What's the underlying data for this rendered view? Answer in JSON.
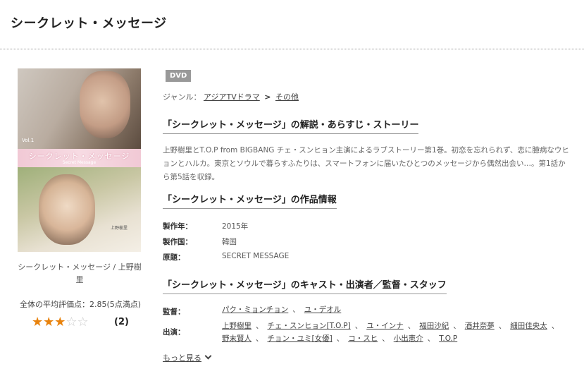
{
  "page_title": "シークレット・メッセージ",
  "cover": {
    "band_text": "シークレット・メッセージ",
    "band_sub": "Secret Message",
    "vol": "Vol.1",
    "cast_mark": "上野樹里"
  },
  "cover_caption": "シークレット・メッセージ / 上野樹里",
  "rating": {
    "summary": "全体の平均評価点：2.85(5点満点)",
    "stars_on": "★★★",
    "stars_off": "☆☆",
    "count": "(2)"
  },
  "badge": "DVD",
  "genre": {
    "label": "ジャンル：",
    "items": [
      "アジアTVドラマ",
      "その他"
    ],
    "separator": ">"
  },
  "headings": {
    "synopsis": "「シークレット・メッセージ」の解説・あらすじ・ストーリー",
    "info": "「シークレット・メッセージ」の作品情報",
    "cast": "「シークレット・メッセージ」のキャスト・出演者／監督・スタッフ"
  },
  "synopsis": "上野樹里とT.O.P from BIGBANG チェ・スンヒョン主演によるラブストーリー第1巻。初恋を忘れられず、恋に臆病なウヒョンとハルカ。東京とソウルで暮らすふたりは、スマートフォンに届いたひとつのメッセージから偶然出会い…。第1話から第5話を収録。",
  "info": [
    {
      "label": "製作年：",
      "value": "2015年"
    },
    {
      "label": "製作国：",
      "value": "韓国"
    },
    {
      "label": "原題：",
      "value": "SECRET MESSAGE"
    }
  ],
  "staff": {
    "director_label": "監督：",
    "directors": [
      "パク・ミョンチョン",
      "ユ・デオル"
    ],
    "cast_label": "出演：",
    "cast_line1": [
      "上野樹里",
      "チェ・スンヒョン[T.O.P]",
      "ユ・インナ",
      "福田沙紀",
      "酒井奈夢",
      "細田佳央太"
    ],
    "cast_line2": [
      "野末賢人",
      "チョン・ユミ[女優]",
      "コ・スヒ",
      "小出恵介",
      "T.O.P"
    ]
  },
  "more_link": "もっと見る"
}
